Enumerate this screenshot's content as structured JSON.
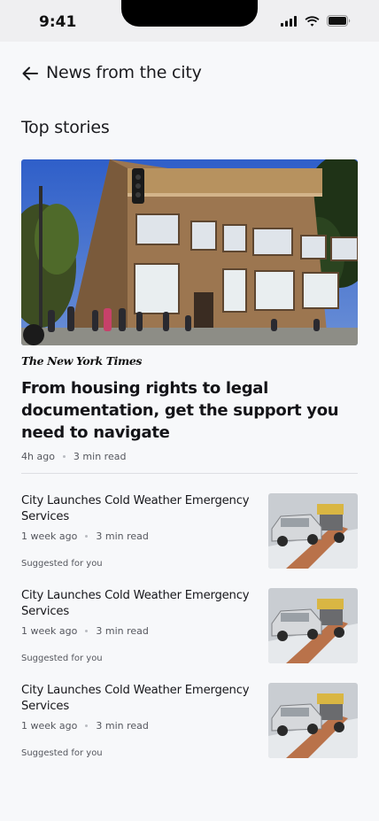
{
  "status_bar": {
    "time": "9:41"
  },
  "header": {
    "back_icon": "arrow-left-icon",
    "title": "News from the city"
  },
  "section": {
    "title": "Top stories"
  },
  "top_story": {
    "publisher": "The New York Times",
    "headline": "From housing rights to legal documentation, get the support you need to navigate",
    "time_ago": "4h ago",
    "read_time": "3 min read"
  },
  "stories": [
    {
      "title": "City Launches Cold Weather Emergency Services",
      "time_ago": "1 week ago",
      "read_time": "3 min read",
      "label": "Suggested for you"
    },
    {
      "title": "City Launches Cold Weather Emergency Services",
      "time_ago": "1 week ago",
      "read_time": "3 min read",
      "label": "Suggested for you"
    },
    {
      "title": "City Launches Cold Weather Emergency Services",
      "time_ago": "1 week ago",
      "read_time": "3 min read",
      "label": "Suggested for you"
    }
  ]
}
